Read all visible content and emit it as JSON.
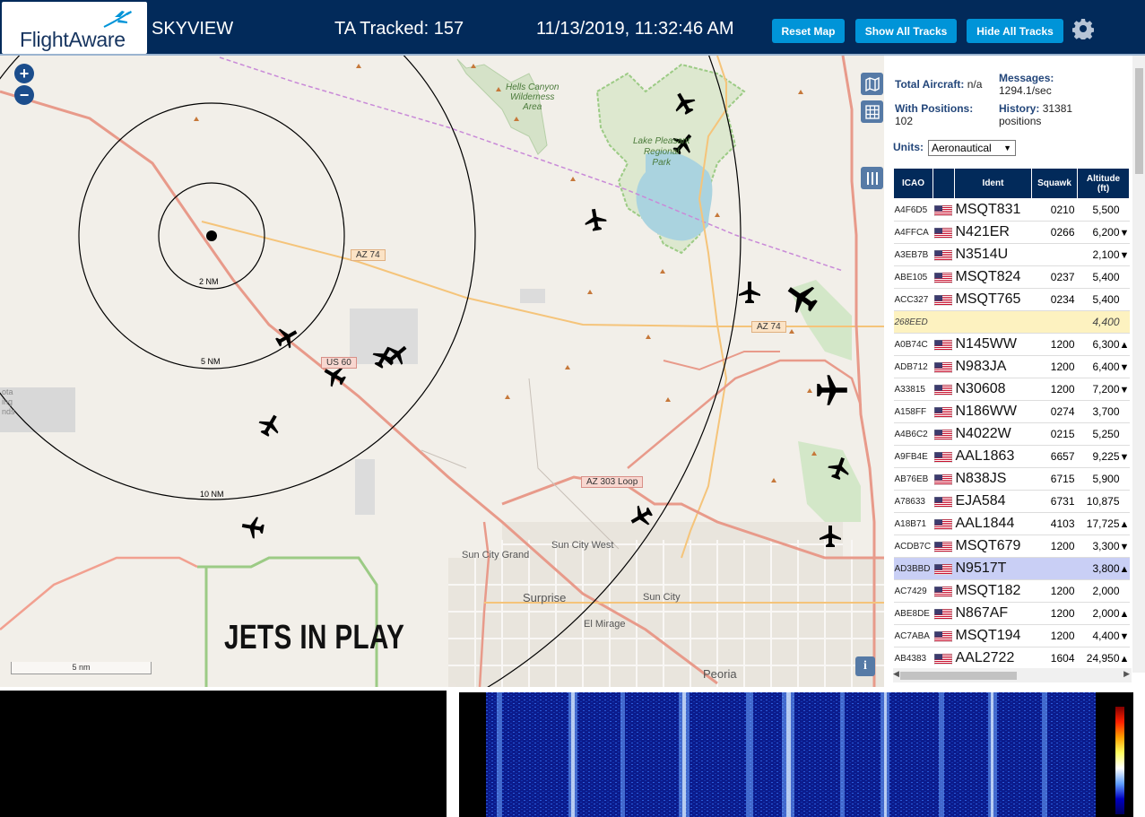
{
  "header": {
    "logo_text": "FlightAware",
    "title": "SKYVIEW",
    "tracked": "TA Tracked: 157",
    "datetime": "11/13/2019, 11:32:46 AM",
    "buttons": {
      "reset": "Reset Map",
      "show": "Show All Tracks",
      "hide": "Hide All Tracks"
    },
    "settings_icon": "gear-icon"
  },
  "map": {
    "overlay_text": "JETS IN PLAY",
    "range_rings": [
      "2 NM",
      "5 NM",
      "10 NM"
    ],
    "scale": "5 nm",
    "labels": {
      "hells_canyon": [
        "Hells Canyon",
        "Wilderness",
        "Area"
      ],
      "lake_pleasant": [
        "Lake Pleasant",
        "Regional",
        "Park"
      ],
      "az74_a": "AZ 74",
      "az74_b": "AZ 74",
      "us60": "US 60",
      "az303": "AZ 303 Loop",
      "sun_city_west": "Sun City West",
      "sun_city_grand": "Sun City Grand",
      "surprise": "Surprise",
      "sun_city": "Sun City",
      "el_mirage": "El Mirage",
      "peoria": "Peoria",
      "dakota": [
        "ota",
        "ing",
        "nds"
      ]
    },
    "zoom_in": "+",
    "zoom_out": "−",
    "info": "i"
  },
  "stats": {
    "total_aircraft_label": "Total Aircraft:",
    "total_aircraft_value": "n/a",
    "messages_label": "Messages:",
    "messages_value": "1294.1/sec",
    "with_positions_label": "With Positions:",
    "with_positions_value": "102",
    "history_label": "History:",
    "history_value": "31381",
    "history_unit": "positions"
  },
  "units": {
    "label": "Units:",
    "selected": "Aeronautical"
  },
  "table": {
    "columns": [
      "ICAO",
      "",
      "Ident",
      "Squawk",
      "Altitude (ft)"
    ],
    "rows": [
      {
        "icao": "A4F6D5",
        "ident": "MSQT831",
        "squawk": "0210",
        "alt": "5,500",
        "trend": ""
      },
      {
        "icao": "A4FFCA",
        "ident": "N421ER",
        "squawk": "0266",
        "alt": "6,200",
        "trend": "▼"
      },
      {
        "icao": "A3EB7B",
        "ident": "N3514U",
        "squawk": "",
        "alt": "2,100",
        "trend": "▼"
      },
      {
        "icao": "ABE105",
        "ident": "MSQT824",
        "squawk": "0237",
        "alt": "5,400",
        "trend": ""
      },
      {
        "icao": "ACC327",
        "ident": "MSQT765",
        "squawk": "0234",
        "alt": "5,400",
        "trend": ""
      },
      {
        "icao": "268EED",
        "ident": "",
        "squawk": "",
        "alt": "4,400",
        "trend": "",
        "style": "hl"
      },
      {
        "icao": "A0B74C",
        "ident": "N145WW",
        "squawk": "1200",
        "alt": "6,300",
        "trend": "▲"
      },
      {
        "icao": "ADB712",
        "ident": "N983JA",
        "squawk": "1200",
        "alt": "6,400",
        "trend": "▼"
      },
      {
        "icao": "A33815",
        "ident": "N30608",
        "squawk": "1200",
        "alt": "7,200",
        "trend": "▼"
      },
      {
        "icao": "A158FF",
        "ident": "N186WW",
        "squawk": "0274",
        "alt": "3,700",
        "trend": ""
      },
      {
        "icao": "A4B6C2",
        "ident": "N4022W",
        "squawk": "0215",
        "alt": "5,250",
        "trend": ""
      },
      {
        "icao": "A9FB4E",
        "ident": "AAL1863",
        "squawk": "6657",
        "alt": "9,225",
        "trend": "▼"
      },
      {
        "icao": "AB76EB",
        "ident": "N838JS",
        "squawk": "6715",
        "alt": "5,900",
        "trend": ""
      },
      {
        "icao": "A78633",
        "ident": "EJA584",
        "squawk": "6731",
        "alt": "10,875",
        "trend": ""
      },
      {
        "icao": "A18B71",
        "ident": "AAL1844",
        "squawk": "4103",
        "alt": "17,725",
        "trend": "▲"
      },
      {
        "icao": "ACDB7C",
        "ident": "MSQT679",
        "squawk": "1200",
        "alt": "3,300",
        "trend": "▼"
      },
      {
        "icao": "AD3BBD",
        "ident": "N9517T",
        "squawk": "",
        "alt": "3,800",
        "trend": "▲",
        "style": "sel"
      },
      {
        "icao": "AC7429",
        "ident": "MSQT182",
        "squawk": "1200",
        "alt": "2,000",
        "trend": ""
      },
      {
        "icao": "ABE8DE",
        "ident": "N867AF",
        "squawk": "1200",
        "alt": "2,000",
        "trend": "▲"
      },
      {
        "icao": "AC7ABA",
        "ident": "MSQT194",
        "squawk": "1200",
        "alt": "4,400",
        "trend": "▼"
      },
      {
        "icao": "AB4383",
        "ident": "AAL2722",
        "squawk": "1604",
        "alt": "24,950",
        "trend": "▲"
      }
    ]
  },
  "colors": {
    "header_bg": "#022a5a",
    "button": "#0094d8",
    "highlight_row": "#fdf2c0",
    "selected_row": "#c9cff5"
  }
}
